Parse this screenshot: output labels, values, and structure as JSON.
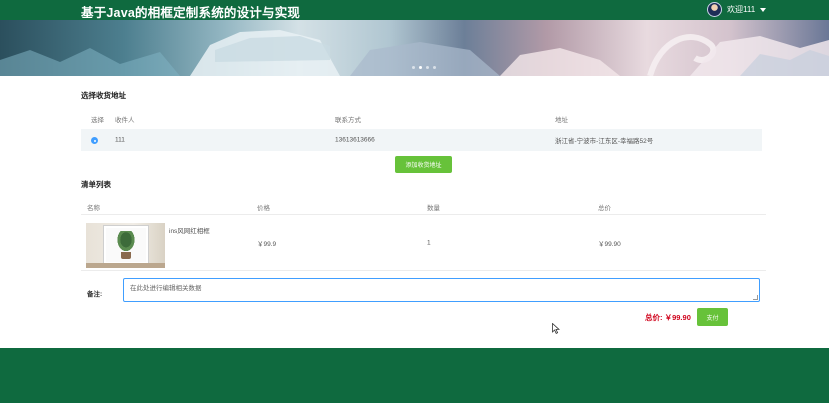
{
  "header": {
    "site_title": "基于Java的相框定制系统的设计与实现",
    "user_label": "欢迎111"
  },
  "address_section": {
    "title": "选择收货地址",
    "columns": [
      "选择",
      "收件人",
      "联系方式",
      "地址"
    ],
    "rows": [
      {
        "selected": true,
        "recipient": "111",
        "phone": "13613613666",
        "address": "浙江省-宁波市-江东区-幸福路52号"
      }
    ],
    "add_button": "添加收货地址"
  },
  "order_section": {
    "title": "清单列表",
    "columns": [
      "名称",
      "价格",
      "数量",
      "总价"
    ],
    "items": [
      {
        "name": "ins风网红相框",
        "price": "￥99.9",
        "quantity": "1",
        "subtotal": "￥99.90"
      }
    ]
  },
  "note": {
    "label": "备注:",
    "placeholder": "在此处进行编辑相关数据"
  },
  "summary": {
    "total_label": "总价:",
    "total_value": "￥99.90",
    "pay_button": "支付"
  },
  "colors": {
    "brand_green": "#0f6a3f",
    "button_green": "#67c23a",
    "accent_blue": "#409eff",
    "price_red": "#d0021b"
  }
}
